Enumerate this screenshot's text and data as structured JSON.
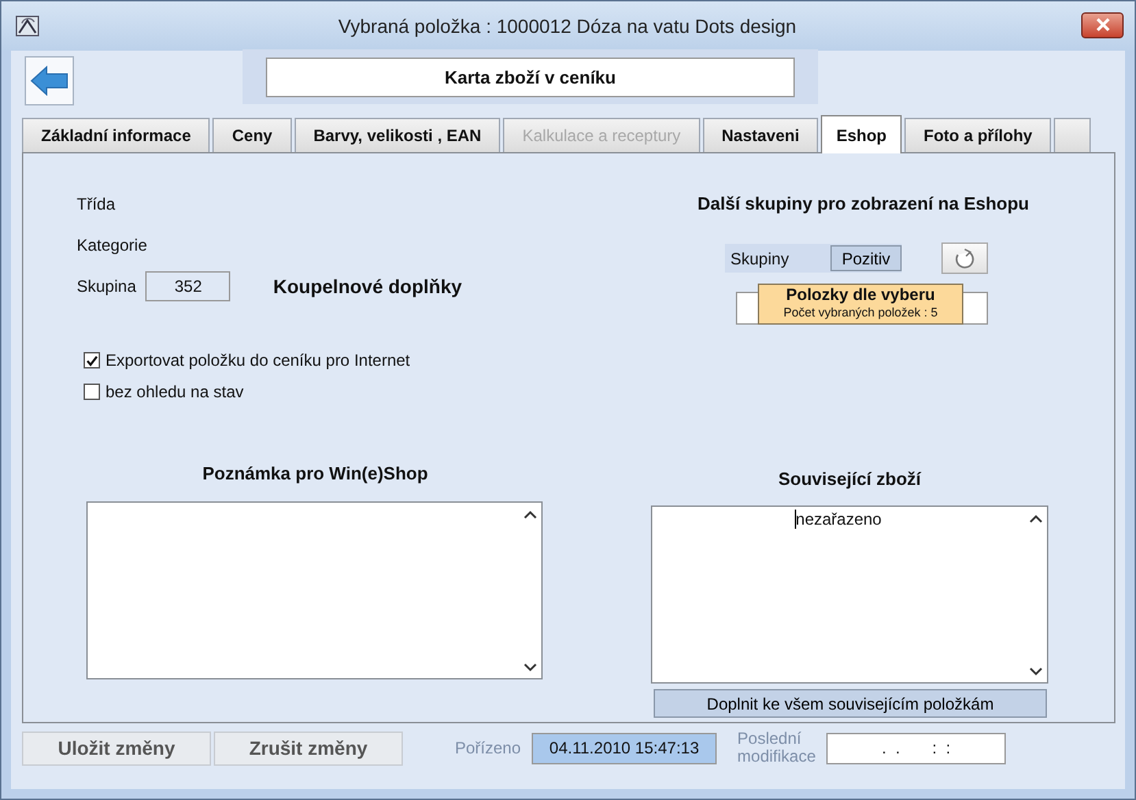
{
  "window": {
    "title": "Vybraná položka : 1000012  Dóza na vatu Dots design"
  },
  "header": {
    "title": "Karta zboží v ceníku"
  },
  "tabs": [
    {
      "label": "Základní informace",
      "selected": false,
      "disabled": false
    },
    {
      "label": "Ceny",
      "selected": false,
      "disabled": false
    },
    {
      "label": "Barvy, velikosti , EAN",
      "selected": false,
      "disabled": false
    },
    {
      "label": "Kalkulace a receptury",
      "selected": false,
      "disabled": true
    },
    {
      "label": "Nastaveni",
      "selected": false,
      "disabled": false
    },
    {
      "label": "Eshop",
      "selected": true,
      "disabled": false
    },
    {
      "label": "Foto a přílohy",
      "selected": false,
      "disabled": false
    }
  ],
  "classification": [
    {
      "label": "Třída"
    },
    {
      "label": "Kategorie"
    },
    {
      "label": "Skupina",
      "code": "352",
      "name": "Koupelnové doplňky"
    }
  ],
  "options": [
    {
      "label": "Exportovat položku do ceníku pro Internet",
      "checked": true
    },
    {
      "label": "bez ohledu na stav",
      "checked": false
    }
  ],
  "note": {
    "heading": "Poznámka pro Win(e)Shop"
  },
  "groups": {
    "heading": "Další skupiny pro zobrazení na Eshopu",
    "label": "Skupiny",
    "mode": "Pozitiv",
    "tooltip": {
      "title": "Polozky dle vyberu",
      "detail": "Počet vybraných položek : 5"
    }
  },
  "related": {
    "heading": "Související zboží",
    "value": "nezařazeno",
    "button": "Doplnit ke všem souvisejícím položkám"
  },
  "footer": {
    "buttons": [
      "Uložit změny",
      "Zrušit změny"
    ],
    "created": {
      "label": "Pořízeno",
      "value": "04.11.2010 15:47:13"
    },
    "modified": {
      "label": "Poslední modifikace",
      "value": ".  .       :  :"
    }
  }
}
